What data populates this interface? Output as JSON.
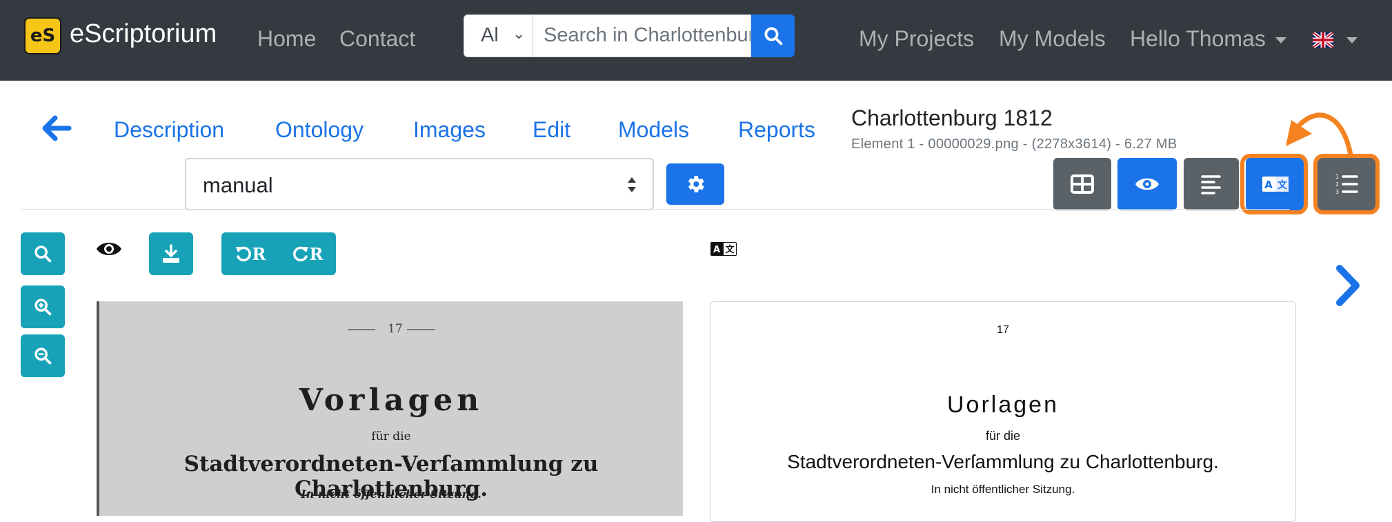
{
  "navbar": {
    "brand_logo": "eS",
    "brand_name": "eScriptorium",
    "links": [
      "Home",
      "Contact"
    ],
    "search": {
      "scope": "Al",
      "placeholder": "Search in Charlottenburg"
    },
    "right_links": [
      "My Projects",
      "My Models"
    ],
    "user_menu": "Hello Thomas",
    "language_flag": "uk-flag-icon"
  },
  "tabs": [
    "Description",
    "Ontology",
    "Images",
    "Edit",
    "Models",
    "Reports"
  ],
  "document": {
    "title": "Charlottenburg 1812",
    "meta": "Element 1 - 00000029.png - (2278x3614) - 6.27 MB"
  },
  "transcription_select": {
    "value": "manual"
  },
  "view_toggles": [
    {
      "icon": "table-icon",
      "color": "#5a6268"
    },
    {
      "icon": "eye-icon",
      "color": "#1a73e8"
    },
    {
      "icon": "align-left-icon",
      "color": "#5a6268"
    },
    {
      "icon": "translate-icon",
      "color": "#1a73e8"
    },
    {
      "icon": "list-ol-icon",
      "color": "#5a6268"
    }
  ],
  "highlight_color": "#f58220",
  "toolbar": {
    "rotate_left_label": "R",
    "rotate_right_label": "R"
  },
  "scan_page": {
    "page_number": "17",
    "heading": "Vorlagen",
    "subheading": "für die",
    "title": "Stadtverordneten-Verſammlung zu Charlottenburg.",
    "note": "In nicht öffentlicher Sitzung."
  },
  "transcription_page": {
    "page_number": "17",
    "heading": "Uorlagen",
    "subheading": "für die",
    "title": "Stadtverordneten-Verſammlung zu Charlottenburg.",
    "note": "In nicht öffentlicher Sitzung."
  },
  "colors": {
    "primary": "#1a73e8",
    "teal": "#17a2b8",
    "navbar": "#343a40"
  }
}
